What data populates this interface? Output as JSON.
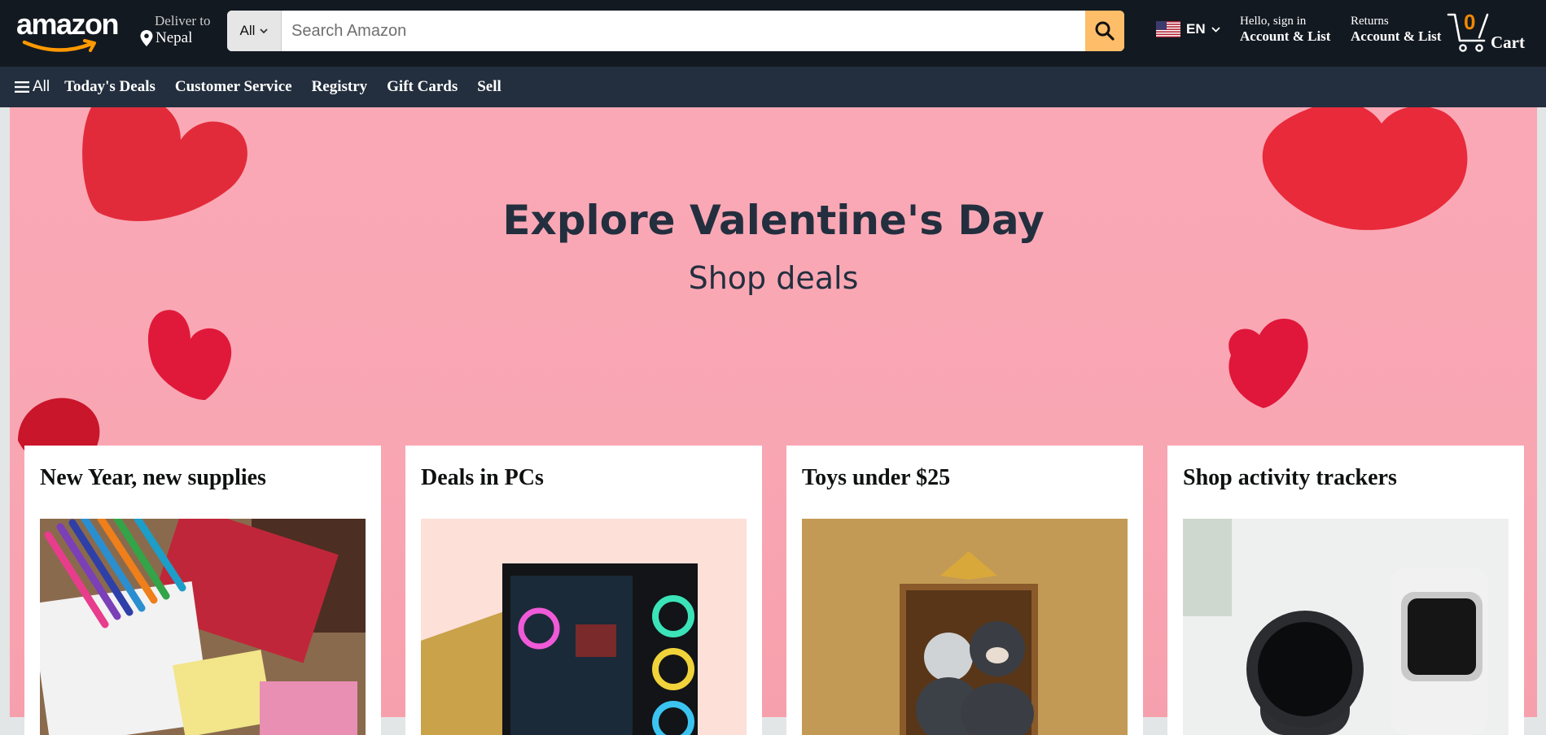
{
  "header": {
    "logo_text": "amazon",
    "deliver_label": "Deliver to",
    "deliver_location": "Nepal",
    "search": {
      "category": "All",
      "placeholder": "Search Amazon"
    },
    "language": "EN",
    "account": {
      "greeting": "Hello, sign in",
      "label": "Account & List"
    },
    "returns": {
      "top": "Returns",
      "label": "Account & List"
    },
    "cart": {
      "count": "0",
      "label": "Cart"
    }
  },
  "subnav": {
    "all_label": "All",
    "items": [
      "Today's Deals",
      "Customer Service",
      "Registry",
      "Gift Cards",
      "Sell"
    ]
  },
  "hero": {
    "title": "Explore Valentine's Day",
    "subtitle": "Shop deals"
  },
  "cards": [
    {
      "title": "New Year, new supplies",
      "image": "school-supplies-image"
    },
    {
      "title": "Deals in PCs",
      "image": "gaming-pc-image"
    },
    {
      "title": "Toys under $25",
      "image": "plush-toys-image"
    },
    {
      "title": "Shop activity trackers",
      "image": "smartwatches-image"
    }
  ],
  "colors": {
    "nav_bg": "#131921",
    "subnav_bg": "#232f3e",
    "search_button": "#febd69",
    "cart_count": "#f08804",
    "hero_bg": "#fba8b6",
    "hero_text": "#232f3e"
  },
  "icons": [
    "location-pin-icon",
    "chevron-down-icon",
    "search-icon",
    "us-flag-icon",
    "cart-icon",
    "hamburger-menu-icon"
  ]
}
